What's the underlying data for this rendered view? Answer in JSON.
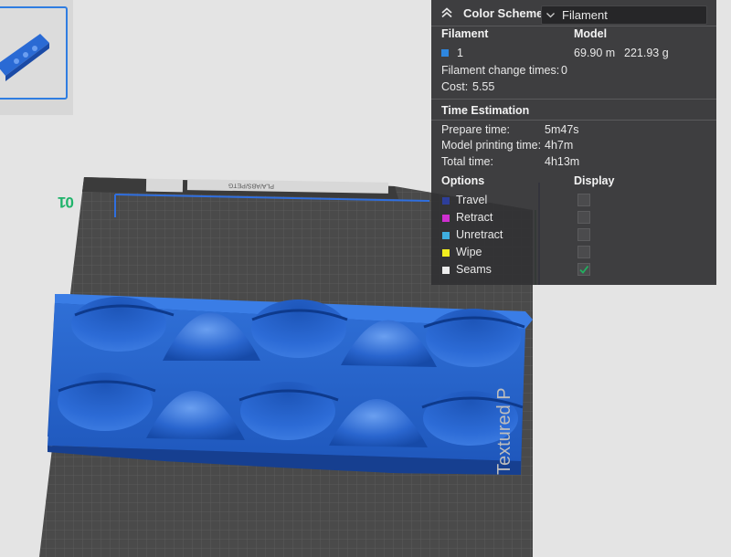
{
  "viewport": {
    "plate_number": "01",
    "bed_label": "Textured P"
  },
  "legend": {
    "header": {
      "title": "Color Scheme",
      "selected_scheme": "Filament"
    },
    "filament_table": {
      "col_filament": "Filament",
      "col_model": "Model",
      "rows": [
        {
          "id": "1",
          "length": "69.90 m",
          "weight": "221.93 g",
          "color": "#2e86de"
        }
      ]
    },
    "stats": {
      "filament_change_label": "Filament change times:",
      "filament_change_value": "0",
      "cost_label": "Cost:",
      "cost_value": "5.55"
    },
    "time_estimation": {
      "title": "Time Estimation",
      "items": [
        {
          "label": "Prepare time:",
          "value": "5m47s"
        },
        {
          "label": "Model printing time:",
          "value": "4h7m"
        },
        {
          "label": "Total time:",
          "value": "4h13m"
        }
      ]
    },
    "options": {
      "col_options": "Options",
      "col_display": "Display",
      "items": [
        {
          "label": "Travel",
          "color": "#2d3e9a",
          "checked": false
        },
        {
          "label": "Retract",
          "color": "#cf2fd0",
          "checked": false
        },
        {
          "label": "Unretract",
          "color": "#3faee0",
          "checked": false
        },
        {
          "label": "Wipe",
          "color": "#f2ee1f",
          "checked": false
        },
        {
          "label": "Seams",
          "color": "#ececec",
          "checked": true
        }
      ]
    }
  }
}
